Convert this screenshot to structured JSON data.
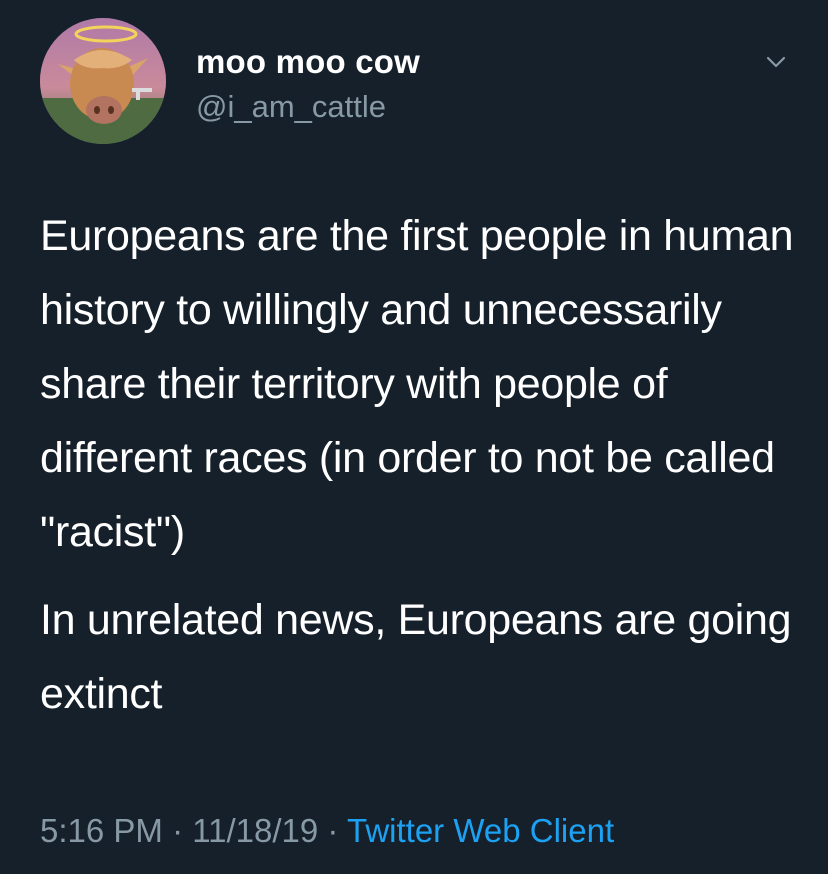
{
  "user": {
    "display_name": "moo moo cow",
    "handle": "@i_am_cattle"
  },
  "tweet": {
    "paragraphs": [
      "Europeans are the first people in human history to willingly and unnecessarily share their territory with people of different races (in order to not be called \"racist\")",
      "In unrelated news, Europeans are going extinct"
    ],
    "time": "5:16 PM",
    "separator": " · ",
    "date": "11/18/19",
    "source": "Twitter Web Client"
  },
  "icons": {
    "menu": "chevron-down-icon",
    "avatar": "cow-with-halo-avatar"
  },
  "colors": {
    "background": "#15202b",
    "text": "#ffffff",
    "secondary": "#8899a6",
    "link": "#1da1f2"
  }
}
